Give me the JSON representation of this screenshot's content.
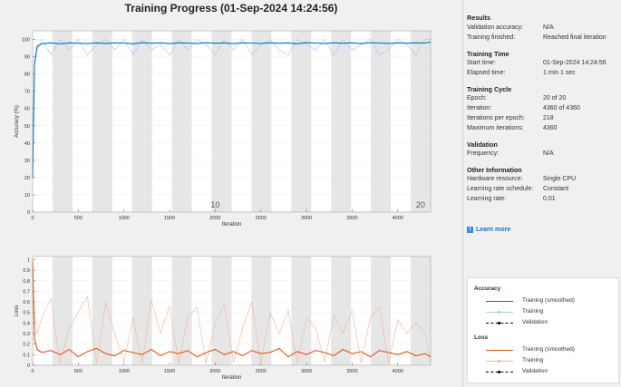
{
  "title": "Training Progress (01-Sep-2024 14:24:56)",
  "panel": {
    "sections": [
      {
        "heading": "Results",
        "rows": [
          [
            "Validation accuracy:",
            "N/A"
          ],
          [
            "Training finished:",
            "Reached final iteration"
          ]
        ]
      },
      {
        "heading": "Training Time",
        "rows": [
          [
            "Start time:",
            "01-Sep-2024 14:24:56"
          ],
          [
            "Elapsed time:",
            "1 min 1 sec"
          ]
        ]
      },
      {
        "heading": "Training Cycle",
        "rows": [
          [
            "Epoch:",
            "20 of 20"
          ],
          [
            "Iteration:",
            "4360 of 4360"
          ],
          [
            "Iterations per epoch:",
            "218"
          ],
          [
            "Maximum iterations:",
            "4360"
          ]
        ]
      },
      {
        "heading": "Validation",
        "rows": [
          [
            "Frequency:",
            "N/A"
          ]
        ]
      },
      {
        "heading": "Other Information",
        "rows": [
          [
            "Hardware resource:",
            "Single CPU"
          ],
          [
            "Learning rate schedule:",
            "Constant"
          ],
          [
            "Learning rate:",
            "0.01"
          ]
        ]
      }
    ],
    "learn_more": "Learn more",
    "learn_more_icon": "info-icon"
  },
  "legend": {
    "groups": [
      {
        "heading": "Accuracy",
        "items": [
          "Training (smoothed)",
          "Training",
          "Validation"
        ],
        "colors": [
          "#0072bd",
          "#9ccbec",
          "#000000"
        ]
      },
      {
        "heading": "Loss",
        "items": [
          "Training (smoothed)",
          "Training",
          "Validation"
        ],
        "colors": [
          "#e0581a",
          "#f5b89a",
          "#000000"
        ]
      }
    ]
  },
  "chart_data": [
    {
      "type": "line",
      "xlabel": "Iteration",
      "ylabel": "Accuracy (%)",
      "xlim": [
        0,
        4360
      ],
      "ylim": [
        0,
        105
      ],
      "xticks": [
        0,
        500,
        1000,
        1500,
        2000,
        2500,
        3000,
        3500,
        4000
      ],
      "yticks": [
        0,
        10,
        20,
        30,
        40,
        50,
        60,
        70,
        80,
        90,
        100
      ],
      "epoch_labels": [
        {
          "epoch": "10",
          "x": 2000
        },
        {
          "epoch": "20",
          "x": 4250
        }
      ],
      "iterations_per_epoch": 218,
      "grid": true,
      "x": [
        0,
        20,
        50,
        100,
        200,
        300,
        400,
        500,
        600,
        700,
        800,
        900,
        1000,
        1100,
        1200,
        1300,
        1400,
        1500,
        1600,
        1700,
        1800,
        1900,
        2000,
        2100,
        2200,
        2300,
        2400,
        2500,
        2600,
        2700,
        2800,
        2900,
        3000,
        3100,
        3200,
        3300,
        3400,
        3500,
        3600,
        3700,
        3800,
        3900,
        4000,
        4100,
        4200,
        4300,
        4360
      ],
      "series": [
        {
          "name": "Training (smoothed)",
          "color": "#0072bd",
          "values": [
            20,
            85,
            96,
            97.5,
            98,
            97.5,
            98,
            97.8,
            97.6,
            98,
            97.7,
            98,
            97.9,
            97.5,
            98.1,
            97.8,
            98,
            97.6,
            98,
            97.9,
            97.7,
            98.1,
            97.8,
            98,
            97.6,
            98,
            97.9,
            97.7,
            98,
            97.8,
            98,
            97.5,
            98.1,
            97.9,
            97.7,
            98,
            97.8,
            98,
            97.6,
            98.1,
            97.9,
            97.7,
            98,
            97.8,
            98,
            97.9,
            98.5
          ]
        },
        {
          "name": "Training",
          "color": "#9ccbec",
          "values": [
            19,
            90,
            94,
            100,
            91,
            100,
            94,
            100,
            91,
            97,
            100,
            94,
            100,
            91,
            100,
            94,
            97,
            91,
            100,
            94,
            100,
            97,
            91,
            100,
            94,
            100,
            91,
            97,
            100,
            94,
            91,
            100,
            97,
            94,
            100,
            91,
            100,
            94,
            97,
            100,
            91,
            94,
            100,
            97,
            91,
            100,
            100
          ]
        }
      ]
    },
    {
      "type": "line",
      "xlabel": "Iteration",
      "ylabel": "Loss",
      "xlim": [
        0,
        4360
      ],
      "ylim": [
        0,
        1.03
      ],
      "xticks": [
        0,
        500,
        1000,
        1500,
        2000,
        2500,
        3000,
        3500,
        4000
      ],
      "yticks": [
        0,
        0.1,
        0.2,
        0.3,
        0.4,
        0.5,
        0.6,
        0.7,
        0.8,
        0.9,
        1
      ],
      "grid": true,
      "x": [
        0,
        20,
        50,
        100,
        200,
        300,
        400,
        500,
        600,
        700,
        800,
        900,
        1000,
        1100,
        1200,
        1300,
        1400,
        1500,
        1600,
        1700,
        1800,
        1900,
        2000,
        2100,
        2200,
        2300,
        2400,
        2500,
        2600,
        2700,
        2800,
        2900,
        3000,
        3100,
        3200,
        3300,
        3400,
        3500,
        3600,
        3700,
        3800,
        3900,
        4000,
        4100,
        4200,
        4300,
        4360
      ],
      "series": [
        {
          "name": "Training (smoothed)",
          "color": "#e0581a",
          "values": [
            0.98,
            0.25,
            0.15,
            0.12,
            0.14,
            0.1,
            0.15,
            0.08,
            0.13,
            0.16,
            0.11,
            0.09,
            0.14,
            0.12,
            0.1,
            0.15,
            0.09,
            0.13,
            0.11,
            0.14,
            0.08,
            0.12,
            0.15,
            0.1,
            0.13,
            0.09,
            0.14,
            0.11,
            0.12,
            0.16,
            0.08,
            0.13,
            0.1,
            0.14,
            0.12,
            0.09,
            0.15,
            0.11,
            0.13,
            0.08,
            0.14,
            0.12,
            0.1,
            0.13,
            0.09,
            0.11,
            0.08
          ]
        },
        {
          "name": "Training",
          "color": "#f5b89a",
          "values": [
            1,
            0.5,
            0.3,
            0.45,
            0.63,
            0.02,
            0.35,
            0.5,
            0.65,
            0.02,
            0.6,
            0.3,
            0.03,
            0.45,
            0.02,
            0.62,
            0.3,
            0.56,
            0.02,
            0.45,
            0.55,
            0.02,
            0.4,
            0.57,
            0.03,
            0.35,
            0.6,
            0.02,
            0.5,
            0.3,
            0.52,
            0.02,
            0.45,
            0.35,
            0.03,
            0.48,
            0.3,
            0.52,
            0.02,
            0.45,
            0.55,
            0.02,
            0.43,
            0.3,
            0.4,
            0.3,
            0.02
          ]
        }
      ]
    }
  ]
}
